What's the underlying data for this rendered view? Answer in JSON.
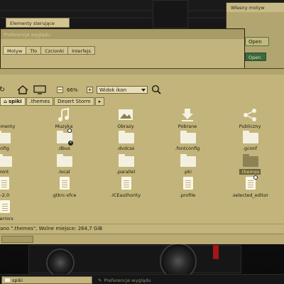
{
  "background_window": {
    "title": "Własny motyw",
    "tab": "Elementy sterujące",
    "buttons": [
      "Open",
      "Open"
    ]
  },
  "preferences_window": {
    "title": "Preferencje wyglądu",
    "tabs": [
      "Motyw",
      "Tło",
      "Czcionki",
      "Interfejs"
    ],
    "active_tab": "Motyw"
  },
  "file_manager": {
    "toolbar": {
      "zoom_out": "−",
      "zoom_level": "66%",
      "zoom_in": "+",
      "view_mode": "Widok ikon"
    },
    "breadcrumbs": [
      "spiki",
      ".themes",
      "Desert Storm",
      "▸"
    ],
    "items": [
      {
        "label": "lementy",
        "icon": "folder-icon"
      },
      {
        "label": "Muzyka",
        "icon": "music-icon"
      },
      {
        "label": "Obrazy",
        "icon": "image-icon"
      },
      {
        "label": "Pobrane",
        "icon": "download-icon"
      },
      {
        "label": "Publiczny",
        "icon": "share-icon"
      },
      {
        "label": "config",
        "icon": "folder-icon"
      },
      {
        "label": ".dbus",
        "icon": "folder-icon"
      },
      {
        "label": ".dvdcss",
        "icon": "folder-icon"
      },
      {
        "label": ".fontconfig",
        "icon": "folder-icon"
      },
      {
        "label": ".gconf",
        "icon": "folder-icon"
      },
      {
        "label": "mint",
        "icon": "folder-icon"
      },
      {
        "label": ".local",
        "icon": "folder-icon"
      },
      {
        "label": ".parallel",
        "icon": "folder-icon"
      },
      {
        "label": ".pki",
        "icon": "folder-icon"
      },
      {
        "label": ".themes",
        "icon": "folder-icon"
      },
      {
        "label": "c-2.0",
        "icon": "file-icon"
      },
      {
        "label": ".gtkrc-xfce",
        "icon": "file-icon"
      },
      {
        "label": ".ICEauthority",
        "icon": "file-icon"
      },
      {
        "label": ".profile",
        "icon": "file-icon"
      },
      {
        "label": ".selected_editor",
        "icon": "file-icon"
      },
      {
        "label": "n-errors",
        "icon": "file-icon"
      }
    ],
    "status": "ano \".themes\", Wolne miejsce: 264,7 GiB"
  },
  "taskbar": {
    "tasks": [
      "spiki",
      "Preferencje wyglądu"
    ]
  },
  "colors": {
    "accent": "#c2b47a",
    "selection": "#6b623a",
    "taskbar": "#161616"
  }
}
